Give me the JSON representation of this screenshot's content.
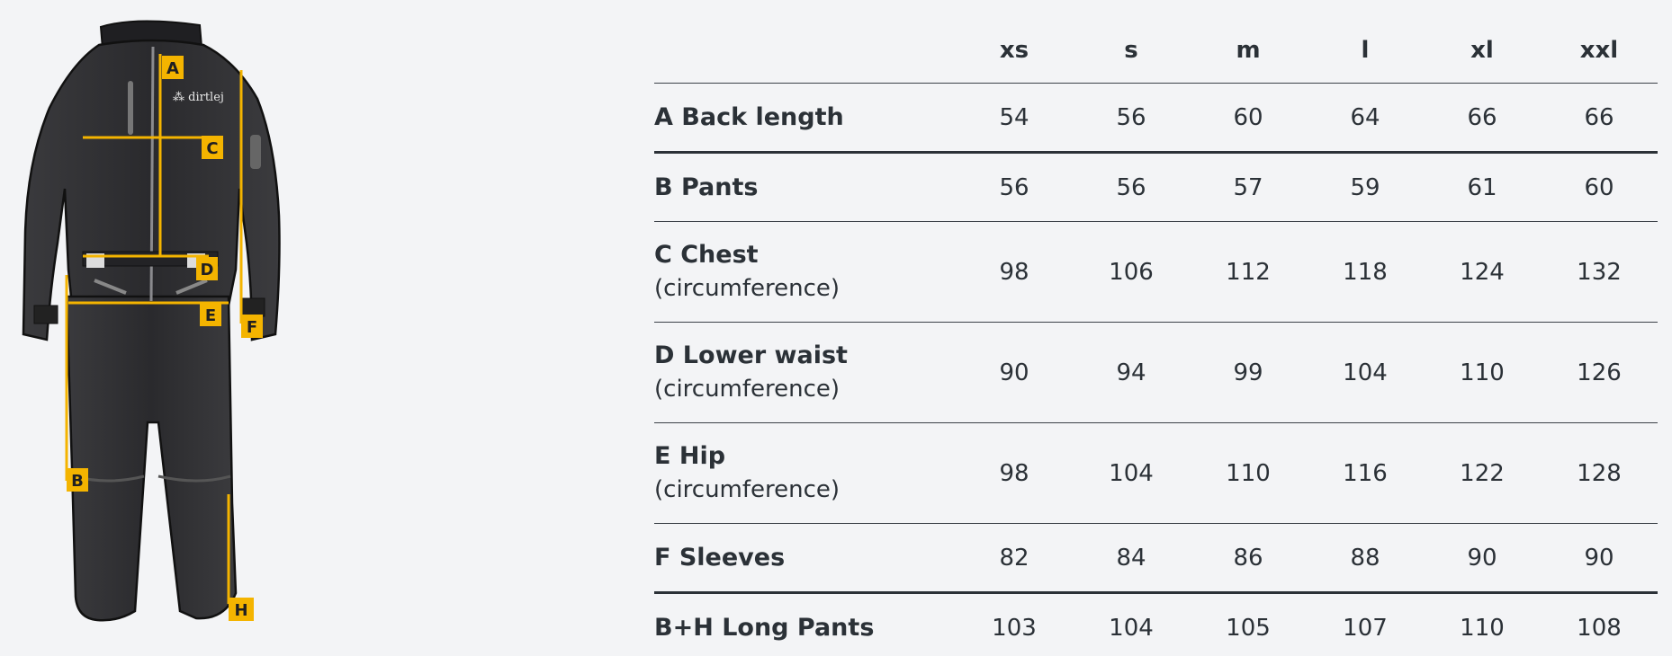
{
  "diagram": {
    "brand_logo_text": "dirtlej",
    "markers": [
      "A",
      "B",
      "C",
      "D",
      "E",
      "F",
      "H"
    ],
    "accent_color": "#f4b400",
    "suit_color": "#2e2e31"
  },
  "table": {
    "sizes": [
      "xs",
      "s",
      "m",
      "l",
      "xl",
      "xxl"
    ],
    "rows": [
      {
        "name": "A Back length",
        "sub": "",
        "values": [
          "54",
          "56",
          "60",
          "64",
          "66",
          "66"
        ]
      },
      {
        "name": "B Pants",
        "sub": "",
        "values": [
          "56",
          "56",
          "57",
          "59",
          "61",
          "60"
        ]
      },
      {
        "name": "C Chest",
        "sub": "(circumference)",
        "values": [
          "98",
          "106",
          "112",
          "118",
          "124",
          "132"
        ]
      },
      {
        "name": "D Lower waist",
        "sub": "(circumference)",
        "values": [
          "90",
          "94",
          "99",
          "104",
          "110",
          "126"
        ]
      },
      {
        "name": "E Hip",
        "sub": "(circumference)",
        "values": [
          "98",
          "104",
          "110",
          "116",
          "122",
          "128"
        ]
      },
      {
        "name": "F Sleeves",
        "sub": "",
        "values": [
          "82",
          "84",
          "86",
          "88",
          "90",
          "90"
        ]
      },
      {
        "name": "B+H Long Pants",
        "sub": "",
        "values": [
          "103",
          "104",
          "105",
          "107",
          "110",
          "108"
        ]
      }
    ]
  }
}
